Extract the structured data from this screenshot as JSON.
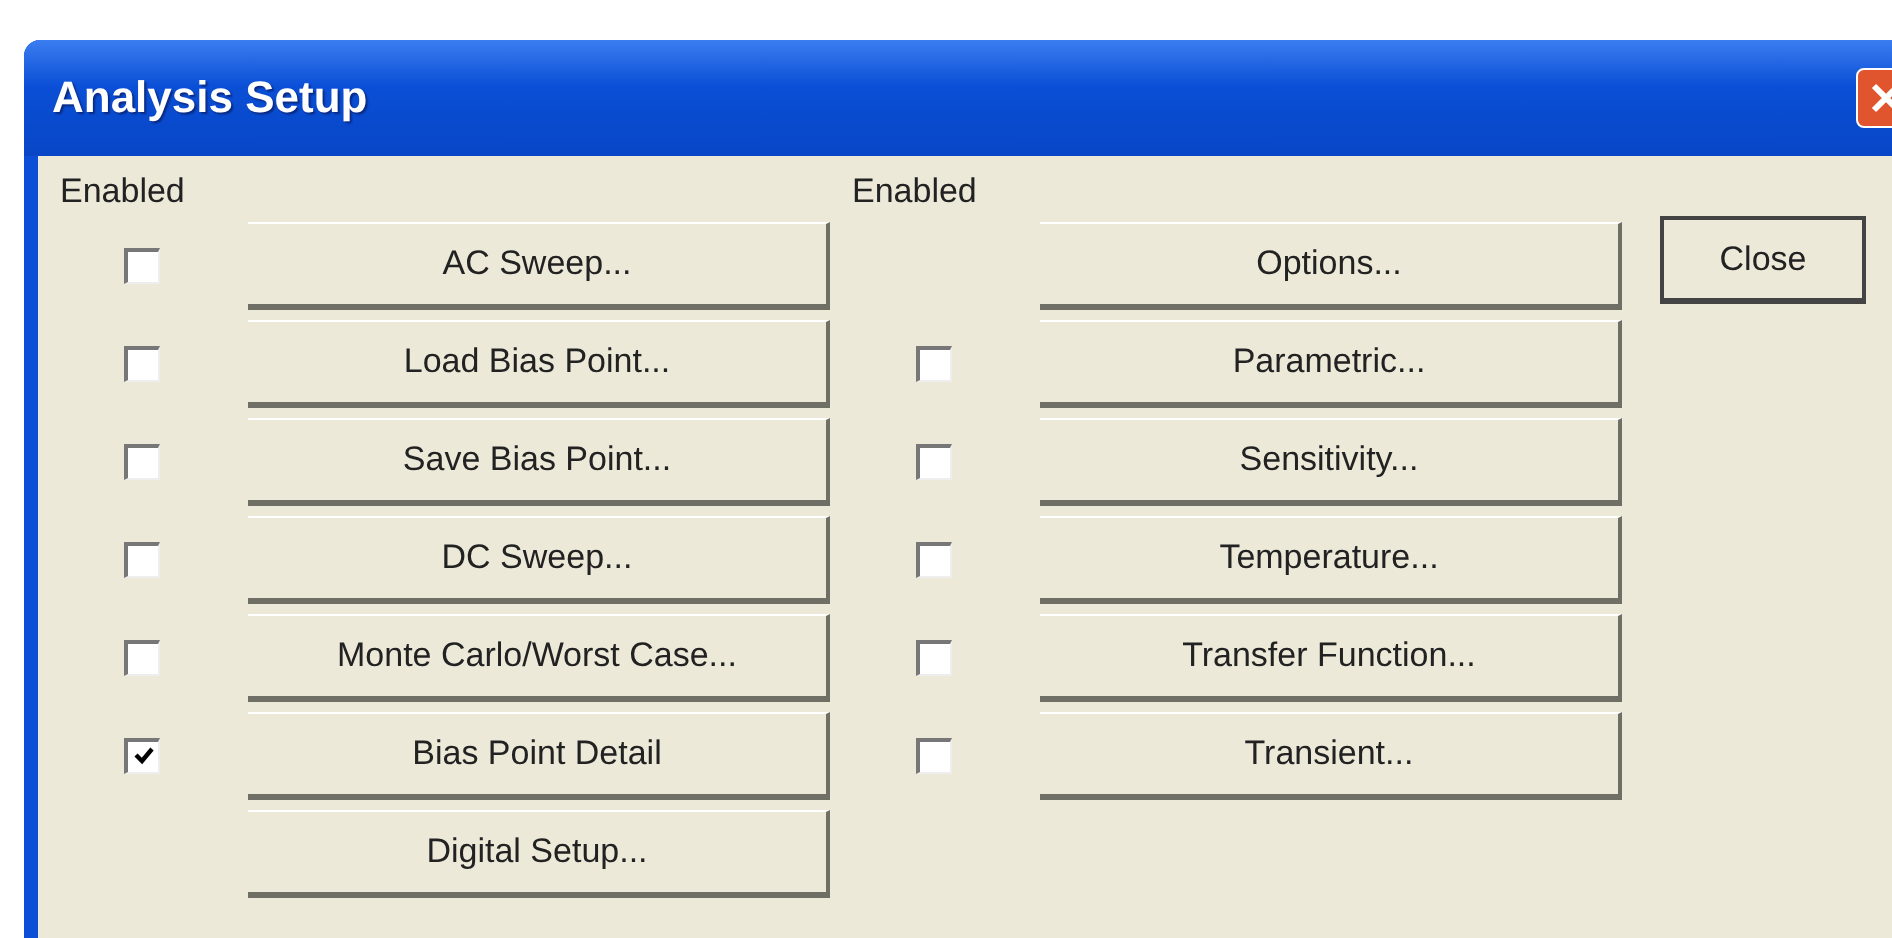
{
  "window": {
    "title": "Analysis Setup"
  },
  "left_column": {
    "header": "Enabled",
    "rows": [
      {
        "label": "AC Sweep...",
        "checked": false
      },
      {
        "label": "Load Bias Point...",
        "checked": false
      },
      {
        "label": "Save Bias Point...",
        "checked": false
      },
      {
        "label": "DC Sweep...",
        "checked": false
      },
      {
        "label": "Monte Carlo/Worst Case...",
        "checked": false
      },
      {
        "label": "Bias Point Detail",
        "checked": true
      },
      {
        "label": "Digital Setup..."
      }
    ]
  },
  "right_column": {
    "header": "Enabled",
    "rows": [
      {
        "label": "Options..."
      },
      {
        "label": "Parametric...",
        "checked": false
      },
      {
        "label": "Sensitivity...",
        "checked": false
      },
      {
        "label": "Temperature...",
        "checked": false
      },
      {
        "label": "Transfer Function...",
        "checked": false
      },
      {
        "label": "Transient...",
        "checked": false
      }
    ]
  },
  "close_button": "Close"
}
